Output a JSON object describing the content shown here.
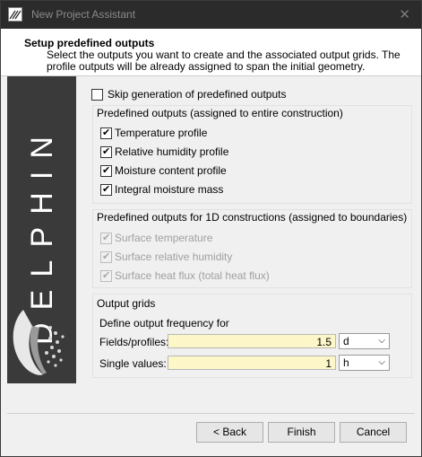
{
  "window": {
    "title": "New Project Assistant",
    "close_glyph": "✕"
  },
  "header": {
    "title": "Setup predefined outputs",
    "subtitle": "Select the outputs you want to create and the associated output grids. The profile outputs will be already assigned to span the initial geometry."
  },
  "banner": {
    "brand": "DELPHIN",
    "icon": "delphin-logo-icon"
  },
  "skip": {
    "label": "Skip generation of predefined outputs",
    "checked": false
  },
  "predefined": {
    "title": "Predefined outputs (assigned to entire construction)",
    "items": [
      {
        "label": "Temperature profile",
        "checked": true
      },
      {
        "label": "Relative humidity profile",
        "checked": true
      },
      {
        "label": "Moisture content profile",
        "checked": true
      },
      {
        "label": "Integral moisture mass",
        "checked": true
      }
    ]
  },
  "boundaries": {
    "title": "Predefined outputs for 1D constructions (assigned to boundaries)",
    "items": [
      {
        "label": "Surface temperature",
        "checked": true,
        "enabled": false
      },
      {
        "label": "Surface relative humidity",
        "checked": true,
        "enabled": false
      },
      {
        "label": "Surface heat flux (total heat flux)",
        "checked": true,
        "enabled": false
      }
    ]
  },
  "grids": {
    "title": "Output grids",
    "caption": "Define output frequency for",
    "fields_label": "Fields/profiles:",
    "fields_value": "1.5",
    "fields_unit": "d",
    "single_label": "Single values:",
    "single_value": "1",
    "single_unit": "h"
  },
  "buttons": {
    "back": "< Back",
    "finish": "Finish",
    "cancel": "Cancel"
  },
  "colors": {
    "field_bg": "#fdf6c8",
    "banner_bg": "#3a3a3a",
    "titlebar_bg": "#2b2b2b"
  }
}
